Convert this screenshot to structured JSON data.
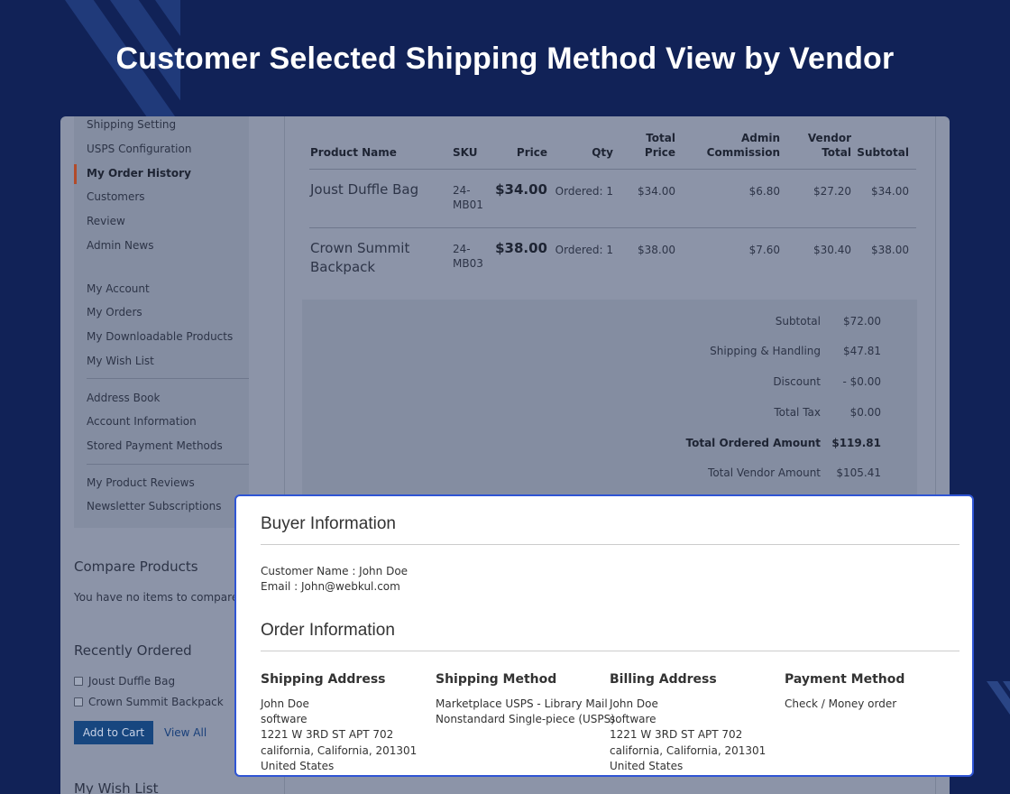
{
  "headline": "Customer Selected Shipping Method View by Vendor",
  "sidebar": {
    "group1": [
      "Shipping Setting",
      "USPS Configuration",
      "My Order History",
      "Customers",
      "Review",
      "Admin News"
    ],
    "group2": [
      "My Account",
      "My Orders",
      "My Downloadable Products",
      "My Wish List"
    ],
    "group3": [
      "Address Book",
      "Account Information",
      "Stored Payment Methods"
    ],
    "group4": [
      "My Product Reviews",
      "Newsletter Subscriptions"
    ],
    "active": "My Order History"
  },
  "compare": {
    "title": "Compare Products",
    "empty": "You have no items to compare."
  },
  "recent": {
    "title": "Recently Ordered",
    "items": [
      "Joust Duffle Bag",
      "Crown Summit Backpack"
    ],
    "add_to_cart": "Add to Cart",
    "view_all": "View All"
  },
  "wishlist": {
    "title": "My Wish List"
  },
  "orders": {
    "headers": {
      "product_name": "Product Name",
      "sku": "SKU",
      "price": "Price",
      "qty": "Qty",
      "total_price_1": "Total",
      "total_price_2": "Price",
      "admin_commission_1": "Admin",
      "admin_commission_2": "Commission",
      "vendor_total_1": "Vendor",
      "vendor_total_2": "Total",
      "subtotal": "Subtotal"
    },
    "rows": [
      {
        "name_1": "Joust Duffle Bag",
        "name_2": "",
        "sku_1": "24-",
        "sku_2": "MB01",
        "price": "$34.00",
        "qty": "Ordered: 1",
        "total_price": "$34.00",
        "admin_commission": "$6.80",
        "vendor_total": "$27.20",
        "subtotal": "$34.00"
      },
      {
        "name_1": "Crown Summit",
        "name_2": "Backpack",
        "sku_1": "24-",
        "sku_2": "MB03",
        "price": "$38.00",
        "qty": "Ordered: 1",
        "total_price": "$38.00",
        "admin_commission": "$7.60",
        "vendor_total": "$30.40",
        "subtotal": "$38.00"
      }
    ],
    "totals": [
      {
        "label": "Subtotal",
        "value": "$72.00",
        "bold": false
      },
      {
        "label": "Shipping & Handling",
        "value": "$47.81",
        "bold": false
      },
      {
        "label": "Discount",
        "value": "- $0.00",
        "bold": false
      },
      {
        "label": "Total Tax",
        "value": "$0.00",
        "bold": false
      },
      {
        "label": "Total Ordered Amount",
        "value": "$119.81",
        "bold": true
      },
      {
        "label": "Total Vendor Amount",
        "value": "$105.41",
        "bold": false
      }
    ]
  },
  "buyer": {
    "title": "Buyer Information",
    "customer_name": "Customer Name : John Doe",
    "email": "Email : John@webkul.com"
  },
  "order_info": {
    "title": "Order Information",
    "shipping_address": {
      "title": "Shipping Address",
      "lines": [
        "John Doe",
        "software",
        "1221 W 3RD ST APT 702",
        "california, California, 201301",
        "United States"
      ]
    },
    "shipping_method": {
      "title": "Shipping Method",
      "lines": [
        "Marketplace USPS - Library Mail",
        "Nonstandard Single-piece (USPS)"
      ]
    },
    "billing_address": {
      "title": "Billing Address",
      "lines": [
        "John Doe",
        "software",
        "1221 W 3RD ST APT 702",
        "california, California, 201301",
        "United States"
      ]
    },
    "payment_method": {
      "title": "Payment Method",
      "lines": [
        "Check / Money order"
      ]
    }
  }
}
